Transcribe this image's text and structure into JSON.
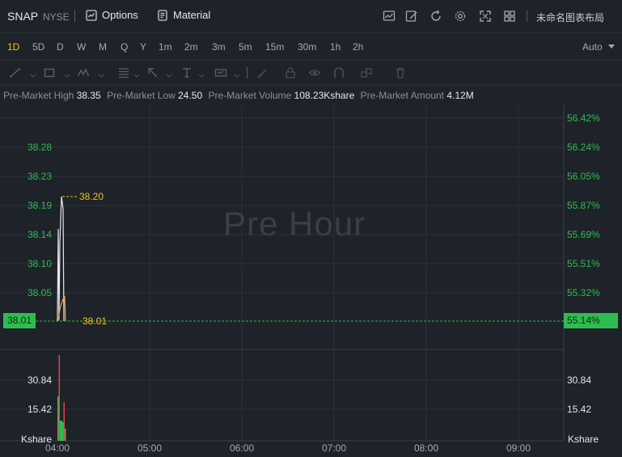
{
  "header": {
    "symbol": "SNAP",
    "exchange": "NYSE",
    "options_label": "Options",
    "material_label": "Material",
    "layout_name": "未命名图表布局"
  },
  "timeframes": [
    "1D",
    "5D",
    "D",
    "W",
    "M",
    "Q",
    "Y",
    "1m",
    "2m",
    "3m",
    "5m",
    "15m",
    "30m",
    "1h",
    "2h"
  ],
  "active_timeframe": "1D",
  "auto_label": "Auto",
  "premarket": {
    "high_label": "Pre-Market High",
    "high_value": "38.35",
    "low_label": "Pre-Market Low",
    "low_value": "24.50",
    "volume_label": "Pre-Market Volume",
    "volume_value": "108.23Kshare",
    "amount_label": "Pre-Market Amount",
    "amount_value": "4.12M"
  },
  "chart_data": {
    "type": "line",
    "watermark": "Pre Hour",
    "price_axis": [
      "38.28",
      "38.23",
      "38.19",
      "38.14",
      "38.10",
      "38.05"
    ],
    "percent_axis": [
      "56.42%",
      "56.24%",
      "56.05%",
      "55.87%",
      "55.69%",
      "55.51%",
      "55.32%"
    ],
    "volume_axis": [
      "30.84",
      "15.42"
    ],
    "volume_unit": "Kshare",
    "x_ticks": [
      "04:00",
      "05:00",
      "06:00",
      "07:00",
      "08:00",
      "09:00"
    ],
    "high_marker": "38.20",
    "last_price": "38.01",
    "last_percent": "55.14%",
    "current_line_label": "38.01",
    "colors": {
      "up": "#2ebd4f",
      "down": "#e0454a",
      "marker": "#f0c419",
      "grid": "#2c323a"
    }
  }
}
